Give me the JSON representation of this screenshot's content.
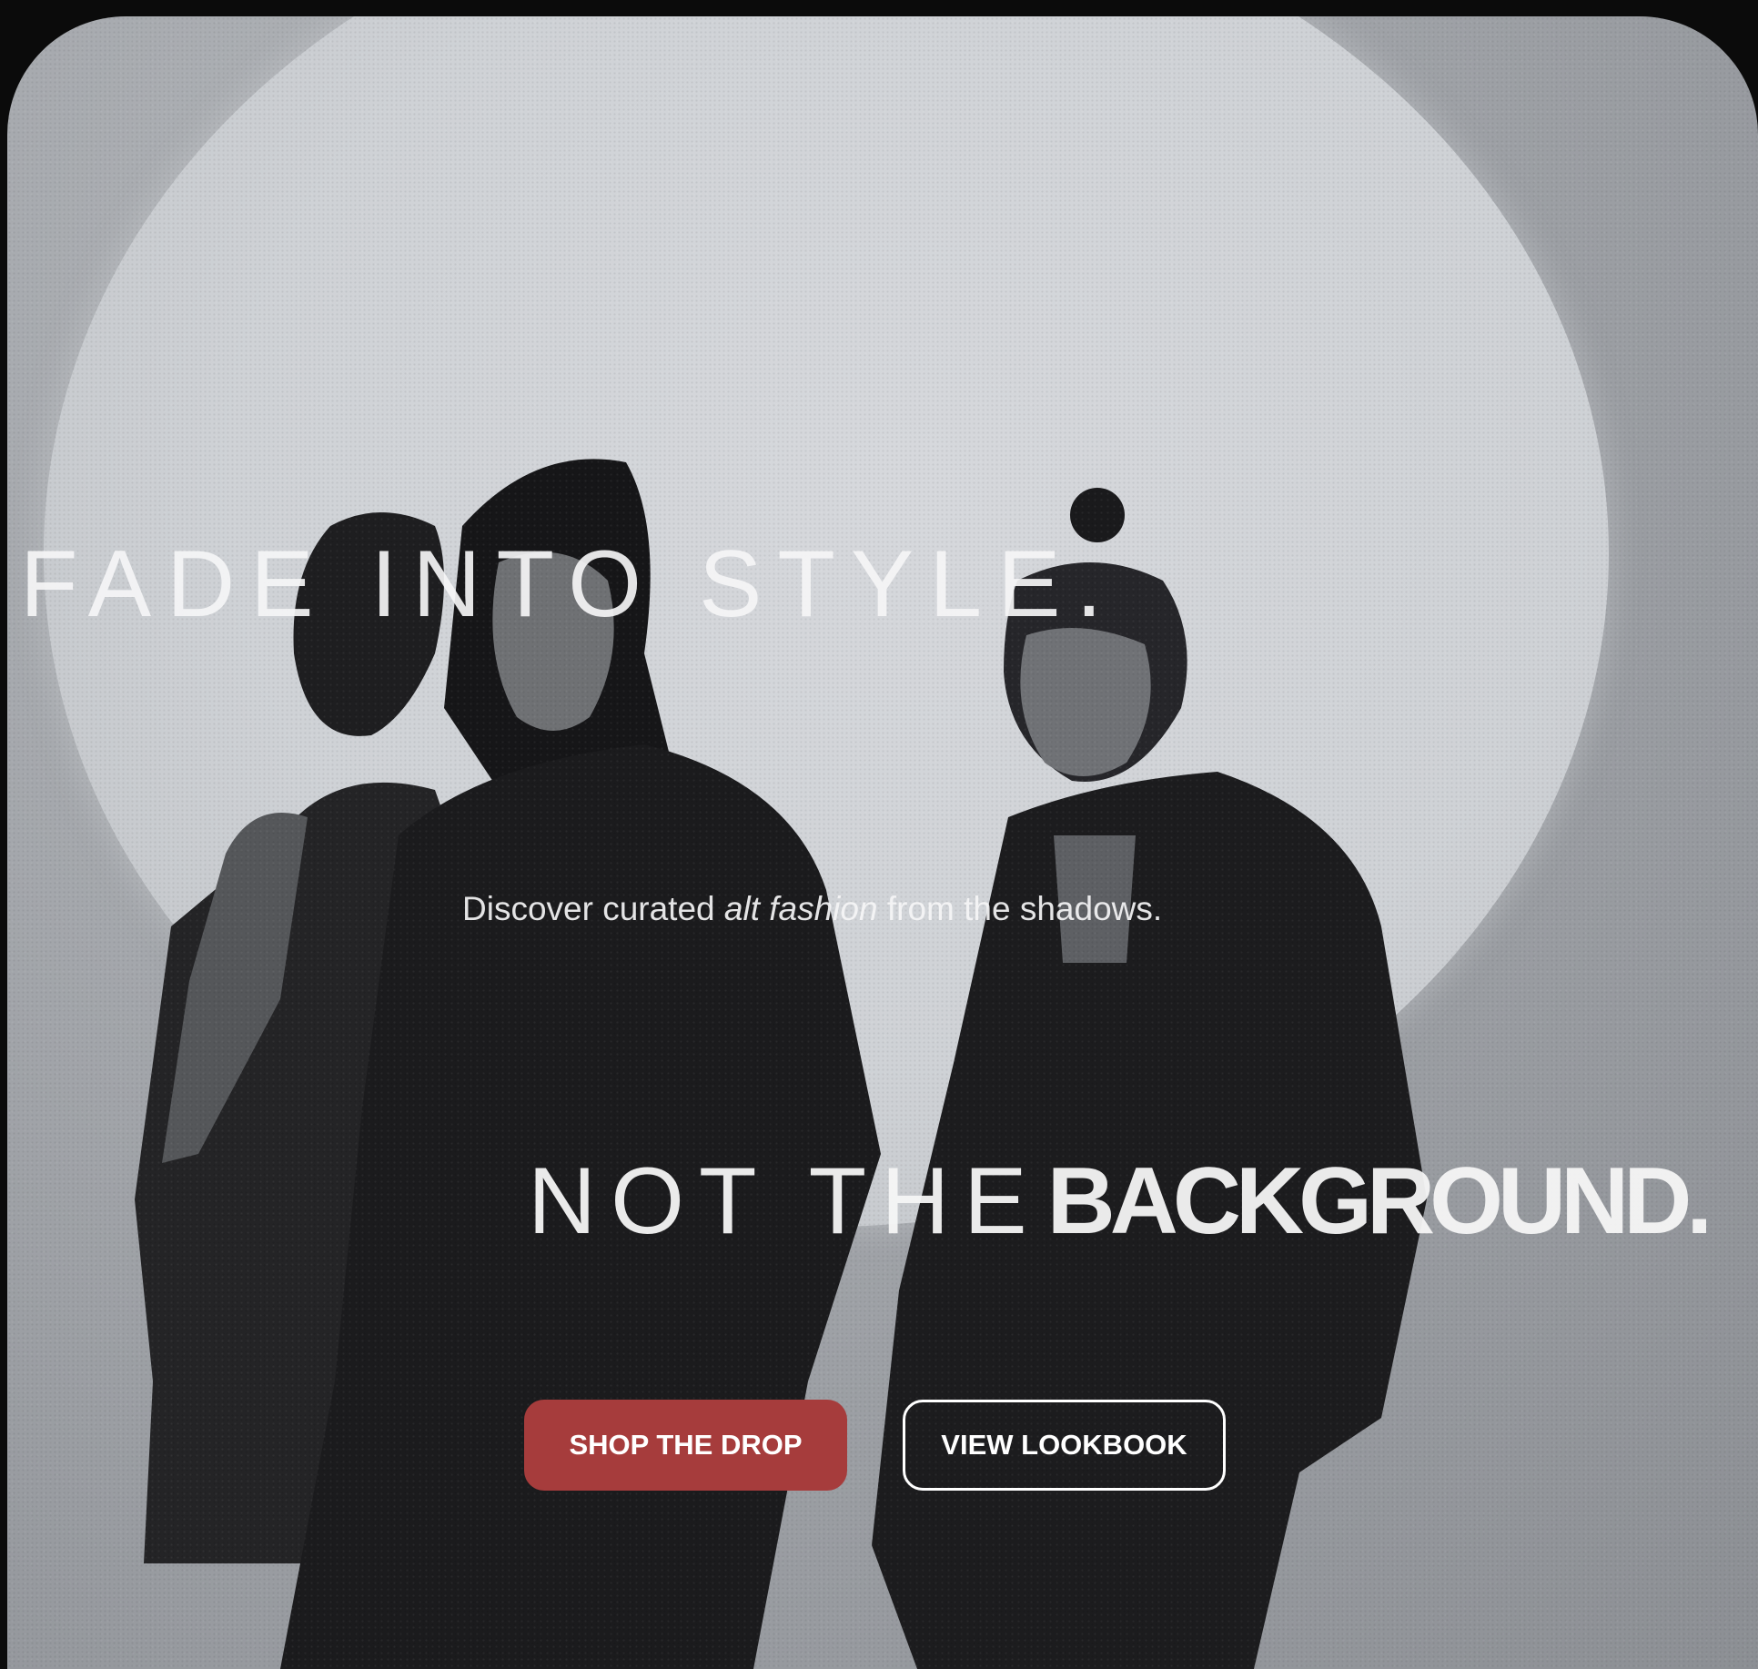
{
  "hero": {
    "headline_top": "FADE INTO STYLE.",
    "subline_before": "Discover curated ",
    "subline_emphasis": "alt fashion",
    "subline_after": " from the shadows.",
    "headline_bottom_spaced": "NOT THE",
    "headline_bottom_tight": "BACKGROUND."
  },
  "actions": {
    "primary_label": "SHOP THE DROP",
    "secondary_label": "VIEW LOOKBOOK"
  },
  "colors": {
    "accent": "#a63c3c",
    "text": "#f5f5f6",
    "page_background": "#0b0b0b"
  }
}
